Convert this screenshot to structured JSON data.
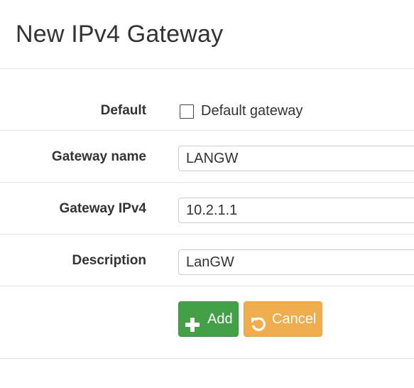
{
  "dialog": {
    "title": "New IPv4 Gateway"
  },
  "form": {
    "default": {
      "label": "Default",
      "checkbox_label": "Default gateway",
      "checked": false
    },
    "gateway_name": {
      "label": "Gateway name",
      "value": "LANGW"
    },
    "gateway_ipv4": {
      "label": "Gateway IPv4",
      "value": "10.2.1.1"
    },
    "description": {
      "label": "Description",
      "value": "LanGW"
    }
  },
  "actions": {
    "add_label": "Add",
    "add_icon": "plus-icon",
    "cancel_label": "Cancel",
    "cancel_icon": "undo-icon"
  },
  "colors": {
    "add_button": "#43a047",
    "cancel_button": "#f0ad4e",
    "divider": "#e3e3e3"
  }
}
